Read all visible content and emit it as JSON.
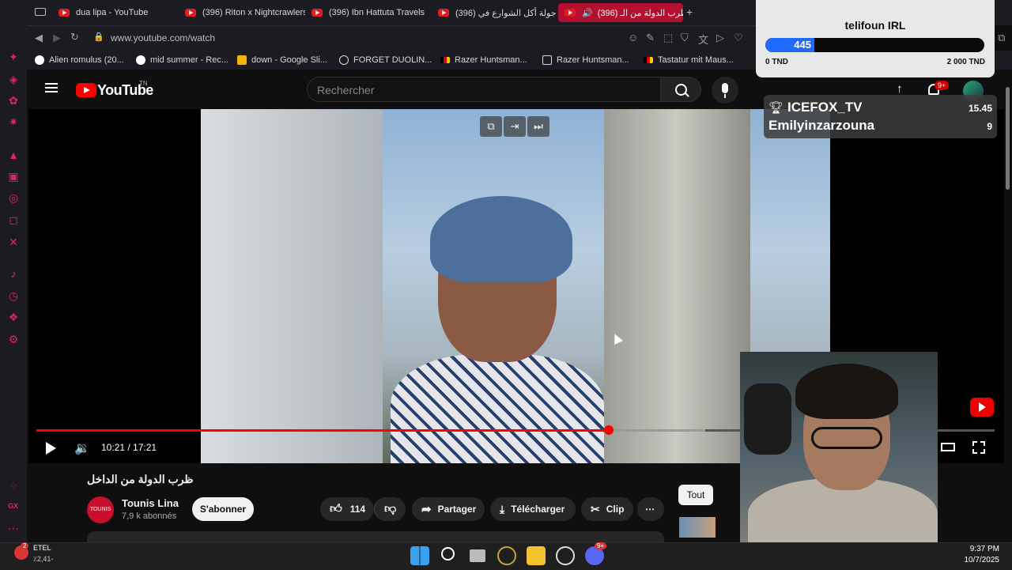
{
  "browser": {
    "tabs": [
      {
        "label": "dua lipa - YouTube"
      },
      {
        "label": "(396) Riton x Nightcrawlers"
      },
      {
        "label": "(396) Ibn Hattuta Travels"
      },
      {
        "label": "(396) جولة أكل الشوارع في"
      },
      {
        "label": "(396) ظرب الدولة من الـ"
      }
    ],
    "url": "www.youtube.com/watch",
    "bookmarks": [
      {
        "label": "Alien romulus (20..."
      },
      {
        "label": "mid summer - Rec..."
      },
      {
        "label": "down - Google Sli..."
      },
      {
        "label": "FORGET DUOLIN..."
      },
      {
        "label": "Razer Huntsman..."
      },
      {
        "label": "Razer Huntsman..."
      },
      {
        "label": "Tastatur mit Maus..."
      }
    ]
  },
  "youtube": {
    "logo": "YouTube",
    "region": "TN",
    "search_placeholder": "Rechercher",
    "notif_count": "9+"
  },
  "player": {
    "current_time": "10:21",
    "duration": "17:21",
    "time_display": "10:21 / 17:21",
    "progress_fraction": 0.597,
    "buffered_fraction": 0.698
  },
  "video": {
    "title": "ظرب الدولة من الداخل",
    "channel": "Tounis Lina",
    "subscribers": "7,9 k abonnés",
    "subscribe_label": "S'abonner",
    "likes": "114",
    "share_label": "Partager",
    "download_label": "Télécharger",
    "clip_label": "Clip",
    "filter_label": "Tout",
    "avatar_text": "TOUNIS LINA"
  },
  "donation_goal": {
    "title": "telifoun IRL",
    "current": "445",
    "min": "0 TND",
    "max": "2 000 TND",
    "fraction": 0.2225
  },
  "leaderboard": [
    {
      "name": "ICEFOX_TV",
      "value": "15.45"
    },
    {
      "name": "Emilyinzarzouna",
      "value": "9"
    }
  ],
  "taskbar": {
    "weather_label": "ETEL",
    "weather_sub": "٪2,41-",
    "weather_badge": "2",
    "time": "9:37 PM",
    "date": "10/7/2025",
    "discord_badge": "9+"
  },
  "sidebar": {
    "gx_label": "GX"
  }
}
